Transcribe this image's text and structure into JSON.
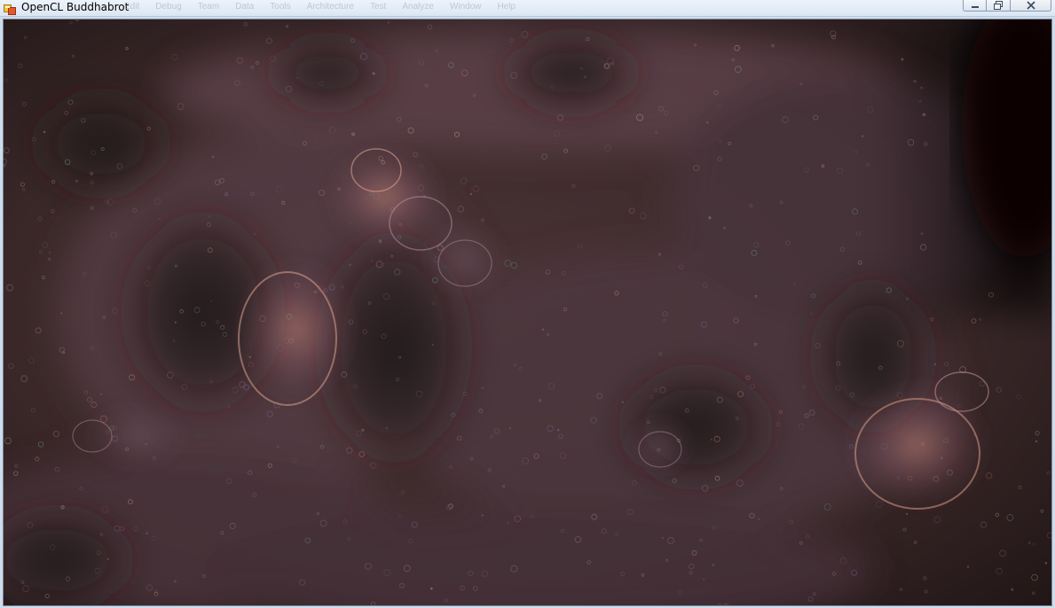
{
  "window": {
    "title": "OpenCL Buddhabrot",
    "ghost_menu": [
      "Edit",
      "Debug",
      "Team",
      "Data",
      "Tools",
      "Architecture",
      "Test",
      "Analyze",
      "Window",
      "Help"
    ],
    "controls": {
      "minimize_icon": "minimize-icon",
      "maximize_icon": "maximize-icon",
      "close_icon": "close-icon"
    }
  },
  "render": {
    "description_icon": "fractal-render",
    "colors": {
      "base": "#2e1f20",
      "haze": "#6b4b55",
      "glow": "#c98a7a",
      "violet": "#7a5a8a",
      "dark_void": "#120b0b"
    }
  }
}
